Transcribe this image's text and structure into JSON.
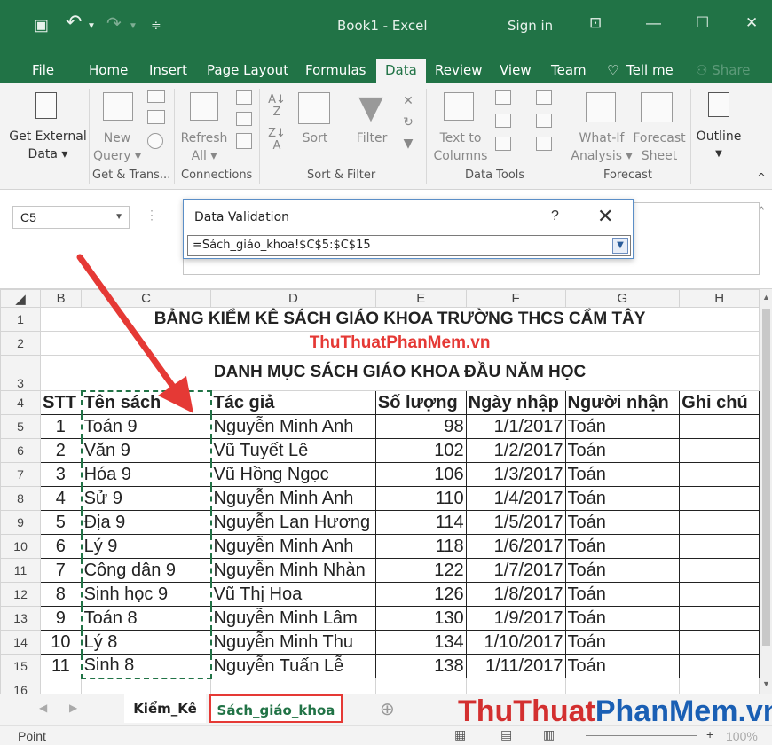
{
  "titlebar": {
    "title": "Book1  -  Excel",
    "sign_in": "Sign in"
  },
  "tabs": [
    "File",
    "Home",
    "Insert",
    "Page Layout",
    "Formulas",
    "Data",
    "Review",
    "View",
    "Team",
    "Tell me",
    "Share"
  ],
  "ribbon": {
    "get_external": [
      "Get External",
      "Data ▾"
    ],
    "new_query": [
      "New",
      "Query ▾"
    ],
    "refresh_all": [
      "Refresh",
      "All ▾"
    ],
    "sort": "Sort",
    "filter": "Filter",
    "text_to_columns": [
      "Text to",
      "Columns"
    ],
    "what_if": [
      "What-If",
      "Analysis ▾"
    ],
    "forecast_sheet": [
      "Forecast",
      "Sheet"
    ],
    "outline": "Outline",
    "groups": [
      "Get & Trans...",
      "Connections",
      "Sort & Filter",
      "Data Tools",
      "Forecast"
    ]
  },
  "name_box": "C5",
  "dialog": {
    "title": "Data Validation",
    "help": "?",
    "close": "✕",
    "reference": "=Sách_giáo_khoa!$C$5:$C$15"
  },
  "columns": [
    "B",
    "C",
    "D",
    "E",
    "F",
    "G",
    "H"
  ],
  "sheet": {
    "title_row1": "BẢNG KIỂM KÊ SÁCH GIÁO KHOA TRƯỜNG THCS CẨM TÂY",
    "title_row2": "ThuThuatPhanMem.vn",
    "title_row3": "DANH MỤC SÁCH GIÁO KHOA ĐẦU NĂM HỌC",
    "headers": [
      "STT",
      "Tên sách",
      "Tác giả",
      "Số lượng",
      "Ngày nhập",
      "Người nhận",
      "Ghi chú"
    ],
    "rows": [
      [
        "1",
        "Toán 9",
        "Nguyễn Minh Anh",
        "98",
        "1/1/2017",
        "Toán",
        ""
      ],
      [
        "2",
        "Văn 9",
        "Vũ Tuyết Lê",
        "102",
        "1/2/2017",
        "Toán",
        ""
      ],
      [
        "3",
        "Hóa 9",
        "Vũ Hồng Ngọc",
        "106",
        "1/3/2017",
        "Toán",
        ""
      ],
      [
        "4",
        "Sử 9",
        "Nguyễn Minh Anh",
        "110",
        "1/4/2017",
        "Toán",
        ""
      ],
      [
        "5",
        "Địa 9",
        "Nguyễn Lan Hương",
        "114",
        "1/5/2017",
        "Toán",
        ""
      ],
      [
        "6",
        "Lý 9",
        "Nguyễn Minh Anh",
        "118",
        "1/6/2017",
        "Toán",
        ""
      ],
      [
        "7",
        "Công dân 9",
        "Nguyễn Minh Nhàn",
        "122",
        "1/7/2017",
        "Toán",
        ""
      ],
      [
        "8",
        "Sinh học 9",
        "Vũ Thị Hoa",
        "126",
        "1/8/2017",
        "Toán",
        ""
      ],
      [
        "9",
        "Toán 8",
        "Nguyễn Minh Lâm",
        "130",
        "1/9/2017",
        "Toán",
        ""
      ],
      [
        "10",
        "Lý 8",
        "Nguyễn Minh Thu",
        "134",
        "1/10/2017",
        "Toán",
        ""
      ],
      [
        "11",
        "Sinh 8",
        "Nguyễn Tuấn Lễ",
        "138",
        "1/11/2017",
        "Toán",
        ""
      ]
    ]
  },
  "sheet_tabs": [
    "Kiểm_Kê",
    "Sách_giáo_khoa"
  ],
  "status": {
    "mode": "Point",
    "zoom": "100%"
  },
  "watermark": [
    "ThuThuat",
    "PhanMem",
    ".vn"
  ],
  "colors": {
    "excel_green": "#217346",
    "highlight_red": "#e53935",
    "watermark_red": "#d32f2f",
    "watermark_blue": "#1a5fb4"
  }
}
